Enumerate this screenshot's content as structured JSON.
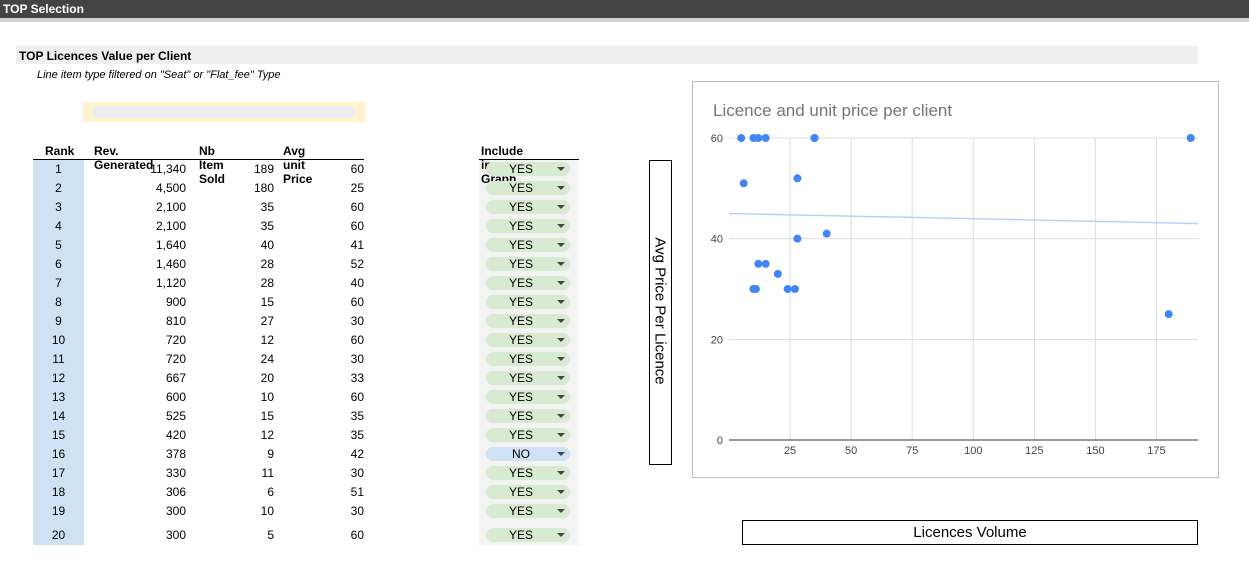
{
  "header": {
    "title": "TOP Selection"
  },
  "section": {
    "title": "TOP Licences Value per Client",
    "subtitle": "Line item type filtered on \"Seat\" or \"Flat_fee\" Type"
  },
  "table": {
    "headers": {
      "rank": "Rank",
      "rev": "Rev. Generated",
      "nb": "Nb Item Sold",
      "avg": "Avg unit Price",
      "include": "Include in Graph"
    },
    "rows": [
      {
        "rank": "1",
        "rev": "11,340",
        "nb": "189",
        "avg": "60",
        "include": "YES"
      },
      {
        "rank": "2",
        "rev": "4,500",
        "nb": "180",
        "avg": "25",
        "include": "YES"
      },
      {
        "rank": "3",
        "rev": "2,100",
        "nb": "35",
        "avg": "60",
        "include": "YES"
      },
      {
        "rank": "4",
        "rev": "2,100",
        "nb": "35",
        "avg": "60",
        "include": "YES"
      },
      {
        "rank": "5",
        "rev": "1,640",
        "nb": "40",
        "avg": "41",
        "include": "YES"
      },
      {
        "rank": "6",
        "rev": "1,460",
        "nb": "28",
        "avg": "52",
        "include": "YES"
      },
      {
        "rank": "7",
        "rev": "1,120",
        "nb": "28",
        "avg": "40",
        "include": "YES"
      },
      {
        "rank": "8",
        "rev": "900",
        "nb": "15",
        "avg": "60",
        "include": "YES"
      },
      {
        "rank": "9",
        "rev": "810",
        "nb": "27",
        "avg": "30",
        "include": "YES"
      },
      {
        "rank": "10",
        "rev": "720",
        "nb": "12",
        "avg": "60",
        "include": "YES"
      },
      {
        "rank": "11",
        "rev": "720",
        "nb": "24",
        "avg": "30",
        "include": "YES"
      },
      {
        "rank": "12",
        "rev": "667",
        "nb": "20",
        "avg": "33",
        "include": "YES"
      },
      {
        "rank": "13",
        "rev": "600",
        "nb": "10",
        "avg": "60",
        "include": "YES"
      },
      {
        "rank": "14",
        "rev": "525",
        "nb": "15",
        "avg": "35",
        "include": "YES"
      },
      {
        "rank": "15",
        "rev": "420",
        "nb": "12",
        "avg": "35",
        "include": "YES"
      },
      {
        "rank": "16",
        "rev": "378",
        "nb": "9",
        "avg": "42",
        "include": "NO"
      },
      {
        "rank": "17",
        "rev": "330",
        "nb": "11",
        "avg": "30",
        "include": "YES"
      },
      {
        "rank": "18",
        "rev": "306",
        "nb": "6",
        "avg": "51",
        "include": "YES"
      },
      {
        "rank": "19",
        "rev": "300",
        "nb": "10",
        "avg": "30",
        "include": "YES"
      },
      {
        "rank": "20",
        "rev": "300",
        "nb": "5",
        "avg": "60",
        "include": "YES"
      }
    ]
  },
  "colors": {
    "yes_chip": "#d9ead3",
    "no_chip": "#cfe2f3",
    "rank_bg": "#cfe2f3",
    "filter_bg": "#fff3cf",
    "point": "#4285f4",
    "trendline": "#b6d3f7"
  },
  "chart": {
    "title": "Licence and unit price per client",
    "y_axis_title": "Avg Price Per Licence",
    "x_axis_title": "Licences Volume"
  },
  "chart_data": {
    "type": "scatter",
    "title": "Licence and unit price per client",
    "xlabel": "Licences Volume",
    "ylabel": "Avg Price Per Licence",
    "xlim": [
      0,
      192
    ],
    "ylim": [
      0,
      60
    ],
    "x_ticks": [
      25,
      50,
      75,
      100,
      125,
      150,
      175
    ],
    "y_ticks": [
      0,
      20,
      40,
      60
    ],
    "grid": true,
    "points": [
      {
        "x": 189,
        "y": 60
      },
      {
        "x": 180,
        "y": 25
      },
      {
        "x": 35,
        "y": 60
      },
      {
        "x": 35,
        "y": 60
      },
      {
        "x": 40,
        "y": 41
      },
      {
        "x": 28,
        "y": 52
      },
      {
        "x": 28,
        "y": 40
      },
      {
        "x": 15,
        "y": 60
      },
      {
        "x": 27,
        "y": 30
      },
      {
        "x": 12,
        "y": 60
      },
      {
        "x": 24,
        "y": 30
      },
      {
        "x": 20,
        "y": 33
      },
      {
        "x": 10,
        "y": 60
      },
      {
        "x": 15,
        "y": 35
      },
      {
        "x": 12,
        "y": 35
      },
      {
        "x": 11,
        "y": 30
      },
      {
        "x": 6,
        "y": 51
      },
      {
        "x": 10,
        "y": 30
      },
      {
        "x": 5,
        "y": 60
      }
    ],
    "trendline": {
      "type": "linear",
      "start": {
        "x": 0,
        "y": 45
      },
      "end": {
        "x": 192,
        "y": 43
      }
    }
  }
}
